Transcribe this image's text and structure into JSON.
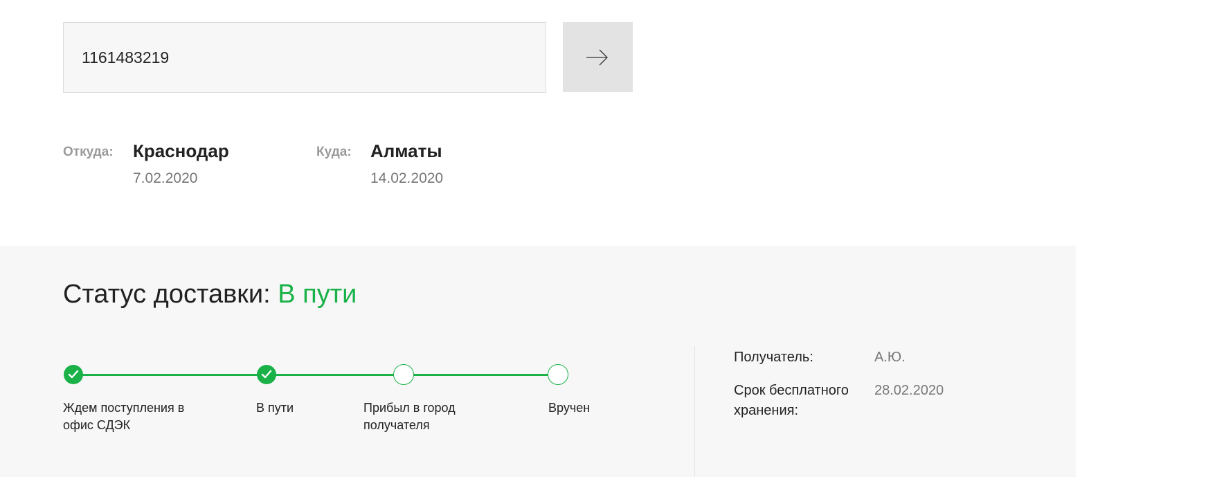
{
  "search": {
    "value": "1161483219",
    "button_icon": "arrow-right-icon"
  },
  "route": {
    "from_label": "Откуда:",
    "from_city": "Краснодар",
    "from_date": "7.02.2020",
    "to_label": "Куда:",
    "to_city": "Алматы",
    "to_date": "14.02.2020"
  },
  "status": {
    "title_prefix": "Статус доставки:",
    "value": "В пути",
    "accent_color": "#1ab248",
    "steps": [
      {
        "label": "Ждем поступления в офис СДЭК",
        "done": true
      },
      {
        "label": "В пути",
        "done": true
      },
      {
        "label": "Прибыл в город получателя",
        "done": false
      },
      {
        "label": "Вручен",
        "done": false
      }
    ]
  },
  "info": {
    "recipient_label": "Получатель:",
    "recipient_value": "А.Ю.",
    "storage_label": "Срок бесплатного хранения:",
    "storage_value": "28.02.2020"
  }
}
